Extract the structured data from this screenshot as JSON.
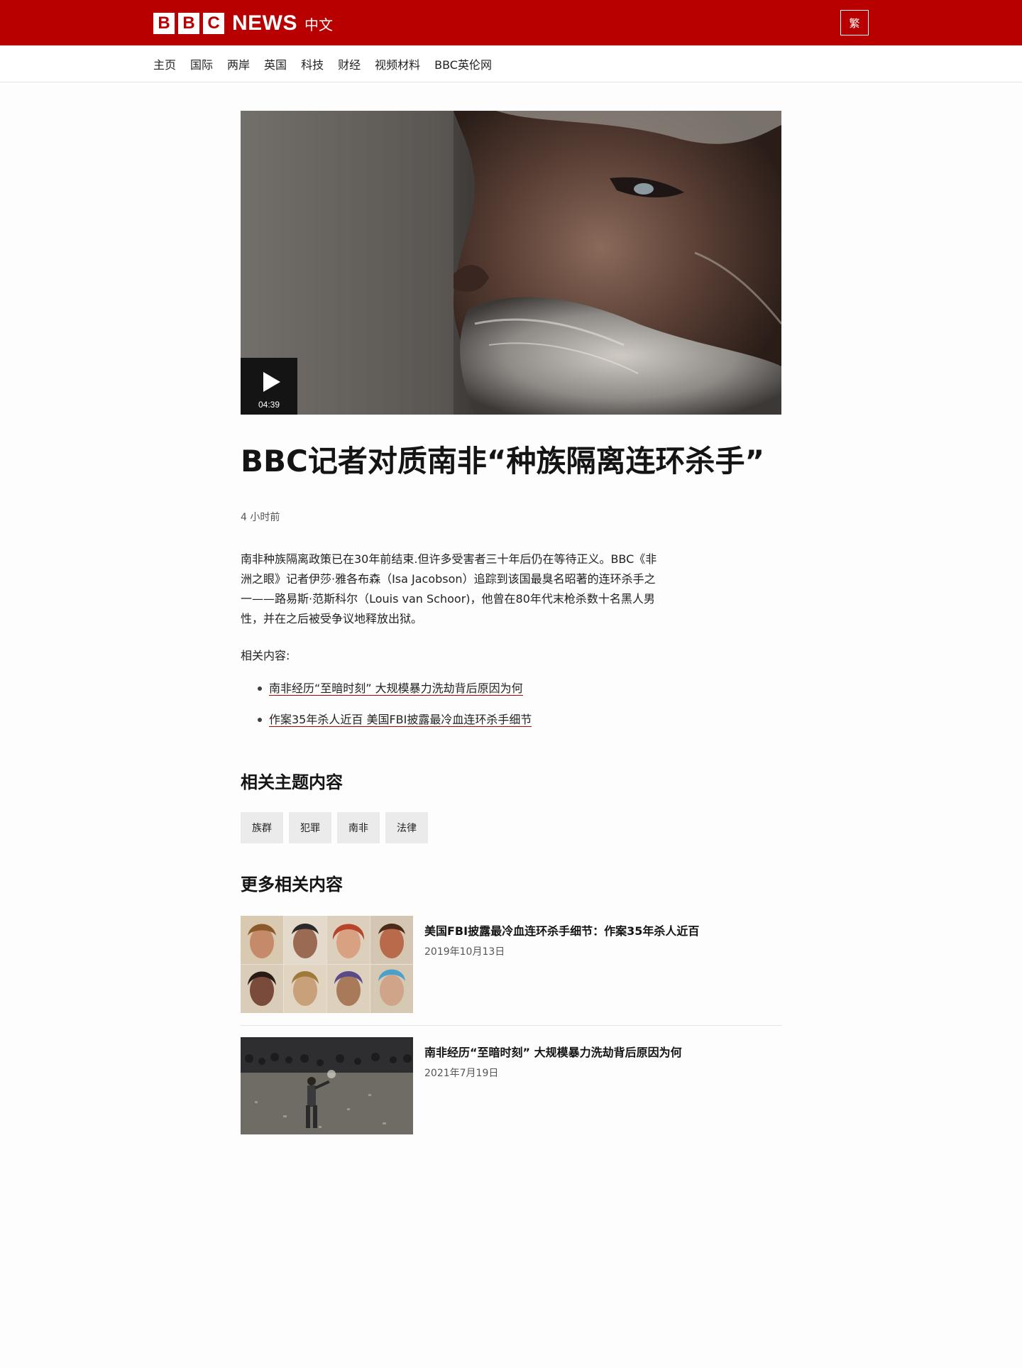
{
  "header": {
    "logo_letters": [
      "B",
      "B",
      "C"
    ],
    "logo_news": "NEWS",
    "logo_lang": "中文",
    "lang_toggle": "繁",
    "brand_color": "#b80000"
  },
  "nav": {
    "items": [
      "主页",
      "国际",
      "两岸",
      "英国",
      "科技",
      "财经",
      "视频材料",
      "BBC英伦网"
    ]
  },
  "article": {
    "media": {
      "icon": "play-icon",
      "duration": "04:39"
    },
    "title": "BBC记者对质南非“种族隔离连环杀手”",
    "timestamp": "4 小时前",
    "summary": "南非种族隔离政策已在30年前结束.但许多受害者三十年后仍在等待正义。BBC《非洲之眼》记者伊莎·雅各布森（Isa Jacobson）追踪到该国最臭名昭著的连环杀手之一——路易斯·范斯科尔（Louis van Schoor)，他曾在80年代末枪杀数十名黑人男性，并在之后被受争议地释放出狱。",
    "related_label": "相关内容:",
    "related_links": [
      "南非经历“至暗时刻” 大规模暴力洗劫背后原因为何",
      "作案35年杀人近百 美国FBI披露最冷血连环杀手细节"
    ]
  },
  "topics": {
    "title": "相关主题内容",
    "tags": [
      "族群",
      "犯罪",
      "南非",
      "法律"
    ]
  },
  "more": {
    "title": "更多相关内容",
    "cards": [
      {
        "title": "美国FBI披露最冷血连环杀手细节：作案35年杀人近百",
        "date": "2019年10月13日"
      },
      {
        "title": "南非经历“至暗时刻” 大规模暴力洗劫背后原因为何",
        "date": "2021年7月19日"
      }
    ]
  }
}
